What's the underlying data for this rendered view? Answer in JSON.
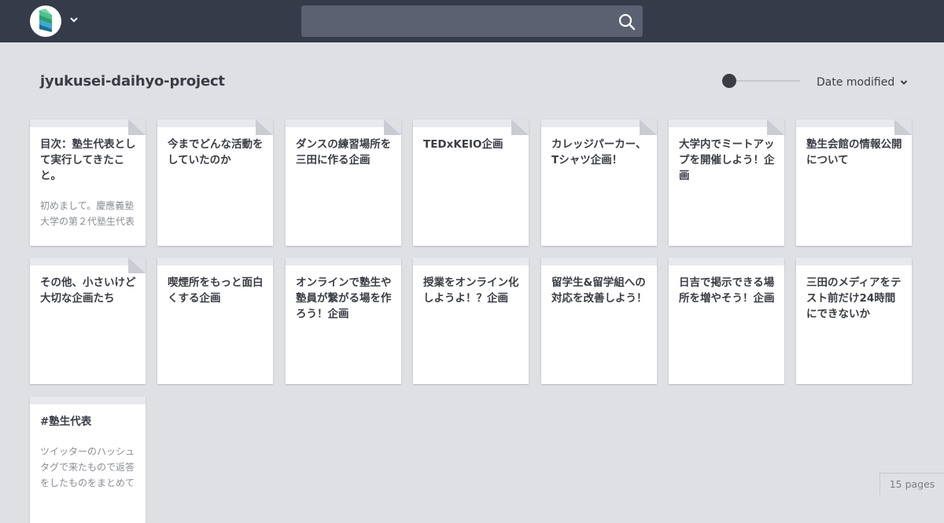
{
  "header": {
    "logo": "scrapbox-logo-icon",
    "menu_icon": "chevron-down-icon",
    "search_placeholder": "",
    "search_icon": "search-icon",
    "background": "#363b49"
  },
  "project": {
    "title": "jyukusei-daihyo-project"
  },
  "controls": {
    "sort_label": "Date modified",
    "zoom_slider_level": 0
  },
  "cards": [
    {
      "title": "目次：塾生代表として実行してきたこと。",
      "desc": "初めまして。慶應義塾大学の第２代塾生代表",
      "folded": true
    },
    {
      "title": "今までどんな活動をしていたのか",
      "desc": "",
      "folded": true
    },
    {
      "title": "ダンスの練習場所を三田に作る企画",
      "desc": "",
      "folded": true
    },
    {
      "title": "TEDxKEIO企画",
      "desc": "",
      "folded": true
    },
    {
      "title": "カレッジパーカー、Tシャツ企画！",
      "desc": "",
      "folded": true
    },
    {
      "title": "大学内でミートアップを開催しよう！企画",
      "desc": "",
      "folded": true
    },
    {
      "title": "塾生会館の情報公開について",
      "desc": "",
      "folded": true
    },
    {
      "title": "その他、小さいけど大切な企画たち",
      "desc": "",
      "folded": true
    },
    {
      "title": "喫煙所をもっと面白くする企画",
      "desc": "",
      "folded": false
    },
    {
      "title": "オンラインで塾生や塾員が繋がる場を作ろう！企画",
      "desc": "",
      "folded": false
    },
    {
      "title": "授業をオンライン化しようよ！？企画",
      "desc": "",
      "folded": false
    },
    {
      "title": "留学生&留学組への対応を改善しよう！",
      "desc": "",
      "folded": false
    },
    {
      "title": "日吉で掲示できる場所を増やそう！企画",
      "desc": "",
      "folded": false
    },
    {
      "title": "三田のメディアをテスト前だけ24時間にできないか",
      "desc": "",
      "folded": false
    },
    {
      "title": "#塾生代表",
      "desc": "ツイッターのハッシュタグで来たもので返答をしたものをまとめて",
      "folded": false
    }
  ],
  "footer": {
    "page_count": "15 pages"
  }
}
